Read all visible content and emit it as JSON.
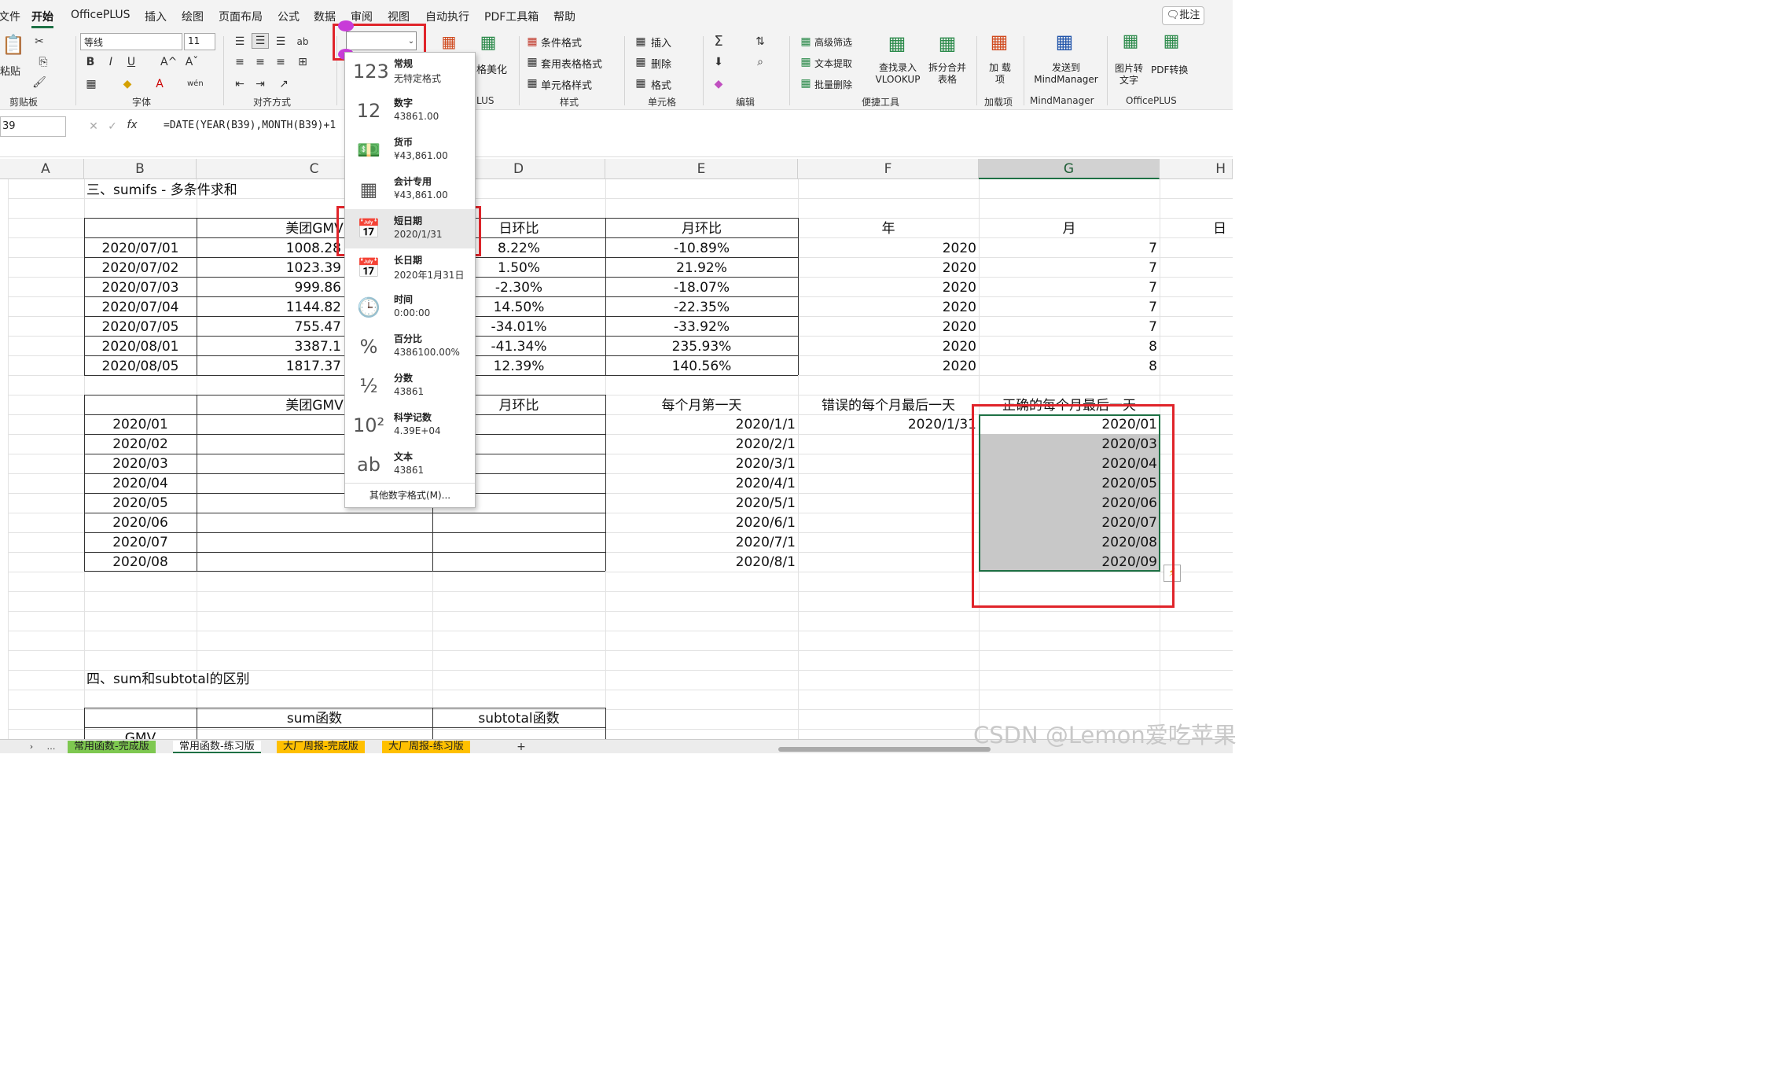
{
  "menu": {
    "items": [
      "文件",
      "开始",
      "OfficePLUS",
      "插入",
      "绘图",
      "页面布局",
      "公式",
      "数据",
      "审阅",
      "视图",
      "自动执行",
      "PDF工具箱",
      "帮助"
    ],
    "comment": "批注"
  },
  "ribbon": {
    "paste": "粘贴",
    "font_name": "等线",
    "font_size": "11",
    "number_format": "",
    "cond_format": "条件格式",
    "table_format": "套用表格格式",
    "cell_style": "单元格样式",
    "insert": "插入",
    "delete": "删除",
    "format": "格式",
    "adv_filter": "高级筛选",
    "text_extract": "文本提取",
    "batch_delete": "批量删除",
    "lookup": "查找录入 VLOOKUP",
    "split_merge": "拆分合并 表格",
    "addin": "加 载项",
    "mind": "发送到 MindManager",
    "img2text": "图片转 文字",
    "pdf": "PDF转换",
    "beautify": "格美化",
    "groups": {
      "clipboard": "剪贴板",
      "font": "字体",
      "align": "对齐方式",
      "style": "样式",
      "cells": "单元格",
      "edit": "编辑",
      "quick": "便捷工具",
      "addins": "加载项",
      "mind": "MindManager",
      "officeplus": "OfficePLUS",
      "plus_partial": "LUS"
    }
  },
  "formula_bar": {
    "name_box": "39",
    "formula": "=DATE(YEAR(B39),MONTH(B39)+1"
  },
  "columns": [
    "A",
    "B",
    "C",
    "D",
    "E",
    "F",
    "G",
    "H"
  ],
  "sheet": {
    "title3": "三、sumifs - 多条件求和",
    "t1_headers": {
      "c": "美团GMV",
      "d": "日环比",
      "e": "月环比",
      "f": "年",
      "g": "月",
      "h": "日"
    },
    "t1_rows": [
      {
        "b": "2020/07/01",
        "c": "1008.28",
        "d": "8.22%",
        "e": "-10.89%",
        "f": "2020",
        "g": "7"
      },
      {
        "b": "2020/07/02",
        "c": "1023.39",
        "d": "1.50%",
        "e": "21.92%",
        "f": "2020",
        "g": "7"
      },
      {
        "b": "2020/07/03",
        "c": "999.86",
        "d": "-2.30%",
        "e": "-18.07%",
        "f": "2020",
        "g": "7"
      },
      {
        "b": "2020/07/04",
        "c": "1144.82",
        "d": "14.50%",
        "e": "-22.35%",
        "f": "2020",
        "g": "7"
      },
      {
        "b": "2020/07/05",
        "c": "755.47",
        "d": "-34.01%",
        "e": "-33.92%",
        "f": "2020",
        "g": "7"
      },
      {
        "b": "2020/08/01",
        "c": "3387.1",
        "d": "-41.34%",
        "e": "235.93%",
        "f": "2020",
        "g": "8"
      },
      {
        "b": "2020/08/05",
        "c": "1817.37",
        "d": "12.39%",
        "e": "140.56%",
        "f": "2020",
        "g": "8"
      }
    ],
    "t2_headers": {
      "c": "美团GMV",
      "d": "月环比",
      "e": "每个月第一天",
      "f": "错误的每个月最后一天",
      "g": "正确的每个月最后一天"
    },
    "t2_rows": [
      {
        "b": "2020/01",
        "e": "2020/1/1",
        "f": "2020/1/31",
        "g": "2020/01"
      },
      {
        "b": "2020/02",
        "e": "2020/2/1",
        "f": "",
        "g": "2020/03"
      },
      {
        "b": "2020/03",
        "e": "2020/3/1",
        "f": "",
        "g": "2020/04"
      },
      {
        "b": "2020/04",
        "e": "2020/4/1",
        "f": "",
        "g": "2020/05"
      },
      {
        "b": "2020/05",
        "e": "2020/5/1",
        "f": "",
        "g": "2020/06"
      },
      {
        "b": "2020/06",
        "e": "2020/6/1",
        "f": "",
        "g": "2020/07"
      },
      {
        "b": "2020/07",
        "e": "2020/7/1",
        "f": "",
        "g": "2020/08"
      },
      {
        "b": "2020/08",
        "e": "2020/8/1",
        "f": "",
        "g": "2020/09"
      }
    ],
    "title4": "四、sum和subtotal的区别",
    "t3_headers": {
      "c": "sum函数",
      "d": "subtotal函数"
    },
    "t3_row1": "GMV"
  },
  "dropdown": {
    "items": [
      {
        "icon": "123",
        "title": "常规",
        "sub": "无特定格式"
      },
      {
        "icon": "12",
        "title": "数字",
        "sub": "43861.00"
      },
      {
        "icon": "💵",
        "title": "货币",
        "sub": "¥43,861.00"
      },
      {
        "icon": "▦",
        "title": "会计专用",
        "sub": " ¥43,861.00"
      },
      {
        "icon": "📅",
        "title": "短日期",
        "sub": "2020/1/31"
      },
      {
        "icon": "📅",
        "title": "长日期",
        "sub": "2020年1月31日"
      },
      {
        "icon": "🕒",
        "title": "时间",
        "sub": "0:00:00"
      },
      {
        "icon": "%",
        "title": "百分比",
        "sub": "4386100.00%"
      },
      {
        "icon": "½",
        "title": "分数",
        "sub": "43861"
      },
      {
        "icon": "10²",
        "title": "科学记数",
        "sub": "4.39E+04"
      },
      {
        "icon": "ab",
        "title": "文本",
        "sub": "43861"
      }
    ],
    "more": "其他数字格式(M)..."
  },
  "tabs": [
    "常用函数-完成版",
    "常用函数-练习版",
    "大厂周报-完成版",
    "大厂周报-练习版"
  ],
  "tab_colors": {
    "green": "#7ec850",
    "yellow": "#ffc000"
  },
  "watermark": "CSDN @Lemon爱吃苹果"
}
